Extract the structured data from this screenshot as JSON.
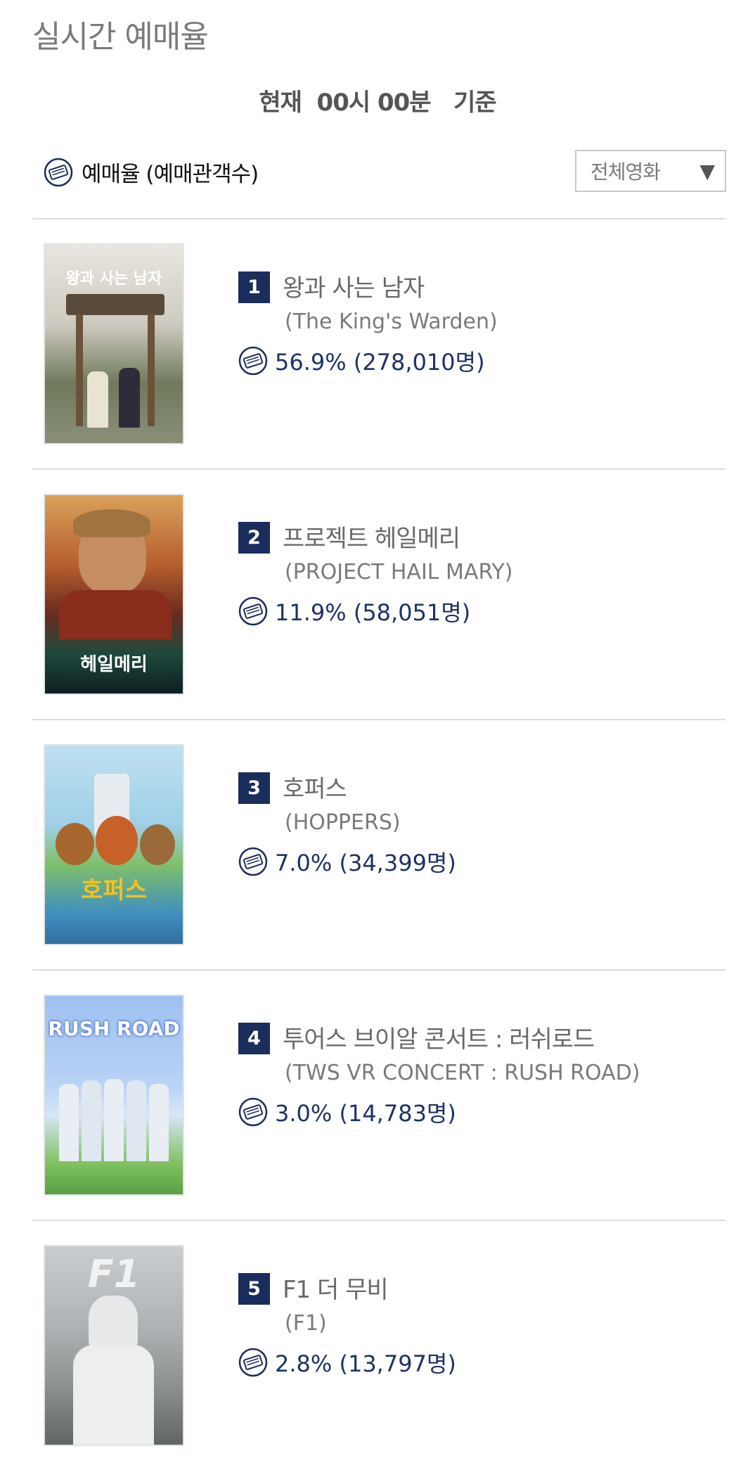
{
  "header": {
    "page_title": "실시간 예매율",
    "subtitle": "현재  00시 00분   기준",
    "legend_label": "예매율 (예매관객수)",
    "ticket_icon": "ticket-icon",
    "filter": {
      "selected": "전체영화",
      "caret": "▼"
    }
  },
  "colors": {
    "navy": "#1b2d5c",
    "stats_text": "#1e3266",
    "divider": "#dcdcdc"
  },
  "movies": [
    {
      "rank": "1",
      "title_kr": "왕과 사는 남자",
      "title_en": "(The King's Warden)",
      "rate": "56.9% (278,010명)",
      "poster_text": "왕과 사는 남자"
    },
    {
      "rank": "2",
      "title_kr": "프로젝트 헤일메리",
      "title_en": "(PROJECT HAIL MARY)",
      "rate": "11.9% (58,051명)",
      "poster_text": "헤일메리"
    },
    {
      "rank": "3",
      "title_kr": "호퍼스",
      "title_en": "(HOPPERS)",
      "rate": "7.0% (34,399명)",
      "poster_text": "호퍼스"
    },
    {
      "rank": "4",
      "title_kr": "투어스 브이알 콘서트 : 러쉬로드",
      "title_en": "(TWS VR CONCERT : RUSH ROAD)",
      "rate": "3.0% (14,783명)",
      "poster_text": "RUSH ROAD"
    },
    {
      "rank": "5",
      "title_kr": "F1 더 무비",
      "title_en": "(F1)",
      "rate": "2.8% (13,797명)",
      "poster_text": "F1"
    }
  ]
}
